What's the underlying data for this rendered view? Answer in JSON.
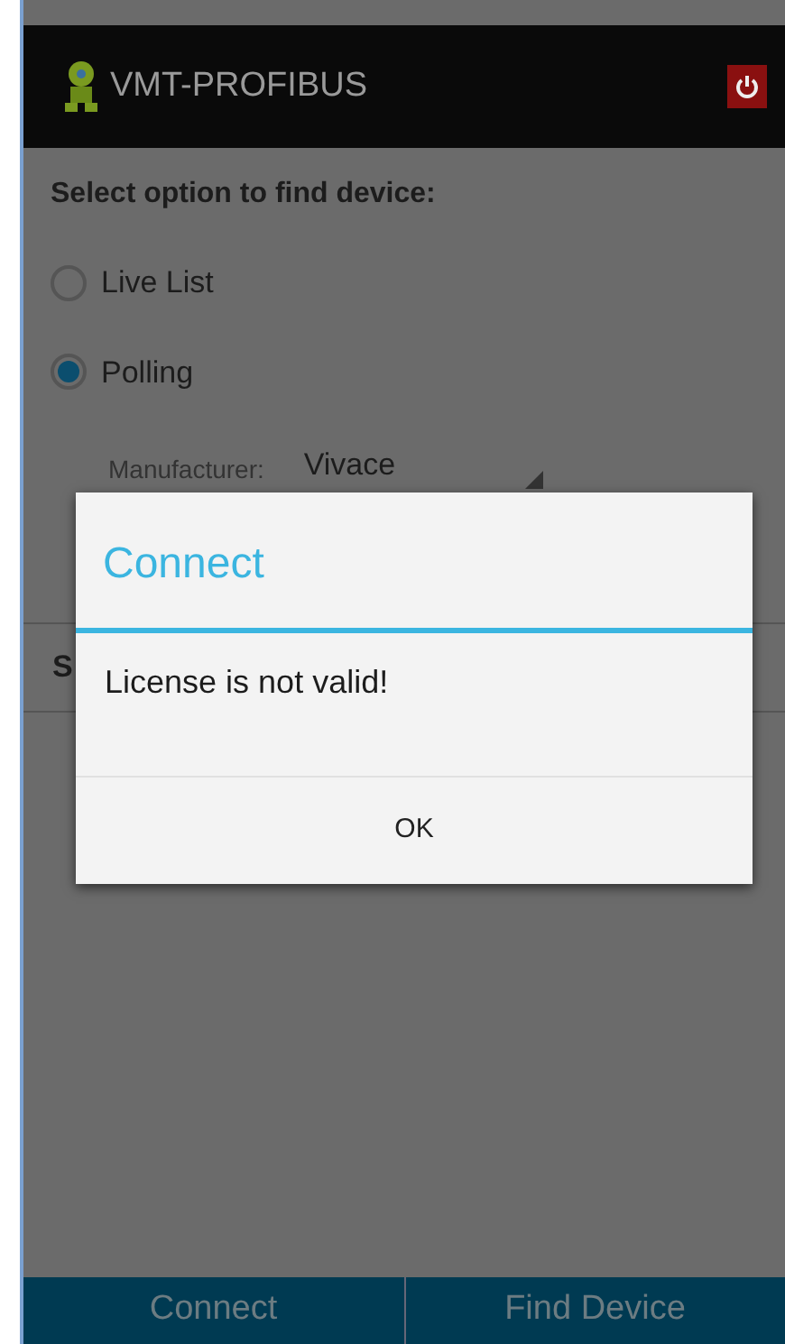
{
  "app_bar": {
    "title": "VMT-PROFIBUS"
  },
  "prompt": "Select option to find device:",
  "options": [
    {
      "label": "Live List",
      "selected": false
    },
    {
      "label": "Polling",
      "selected": true
    }
  ],
  "manufacturer": {
    "label": "Manufacturer:",
    "value": "Vivace"
  },
  "section_label": "S",
  "dialog": {
    "title": "Connect",
    "message": "License is not valid!",
    "button": "OK"
  },
  "bottom_buttons": [
    "Connect",
    "Find Device"
  ]
}
